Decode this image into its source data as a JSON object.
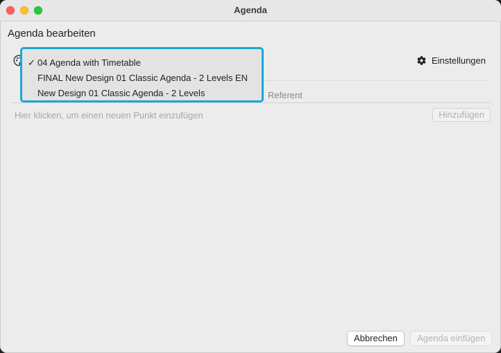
{
  "window": {
    "title": "Agenda"
  },
  "page": {
    "heading": "Agenda bearbeiten"
  },
  "toolbar": {
    "settings_label": "Einstellungen",
    "settings_icon": "gear-icon",
    "palette_icon": "palette-icon"
  },
  "dropdown": {
    "accent_color": "#1aa7d8",
    "selected_index": 0,
    "items": [
      {
        "label": "04 Agenda with Timetable",
        "checked": true
      },
      {
        "label": "FINAL New Design 01 Classic Agenda - 2 Levels EN",
        "checked": false
      },
      {
        "label": "New Design 01 Classic Agenda - 2 Levels",
        "checked": false
      }
    ]
  },
  "table": {
    "columns": [
      "Referent"
    ],
    "insert_hint": "Hier klicken, um einen neuen Punkt einzufügen",
    "add_label": "Hinzufügen"
  },
  "footer": {
    "cancel_label": "Abbrechen",
    "insert_label": "Agenda einfügen"
  }
}
